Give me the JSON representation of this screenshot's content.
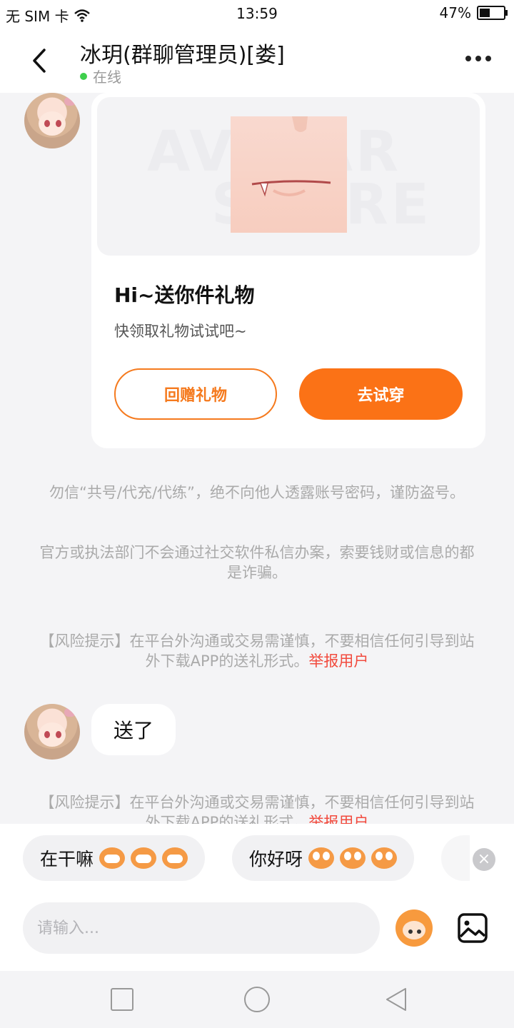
{
  "status_bar": {
    "carrier": "无 SIM 卡",
    "time": "13:59",
    "battery": "47%"
  },
  "header": {
    "title": "冰玥(群聊管理员)[娄]",
    "status": "在线"
  },
  "gift_card": {
    "watermark_line1": "AVATAR",
    "watermark_line2": "STORE",
    "title": "Hi~送你件礼物",
    "subtitle": "快领取礼物试试吧~",
    "return_gift_label": "回赠礼物",
    "try_on_label": "去试穿"
  },
  "notices": {
    "fraud_1": "勿信“共号/代充/代练”，绝不向他人透露账号密码，谨防盗号。",
    "fraud_2": "官方或执法部门不会通过社交软件私信办案，索要钱财或信息的都是诈骗。",
    "risk": "【风险提示】在平台外沟通或交易需谨慎，不要相信任何引导到站外下载APP的送礼形式。",
    "report_link": "举报用户"
  },
  "messages": [
    {
      "text": "送了"
    }
  ],
  "quick_replies": [
    {
      "label": "在干嘛"
    },
    {
      "label": "你好呀"
    }
  ],
  "input": {
    "placeholder": "请输入..."
  }
}
